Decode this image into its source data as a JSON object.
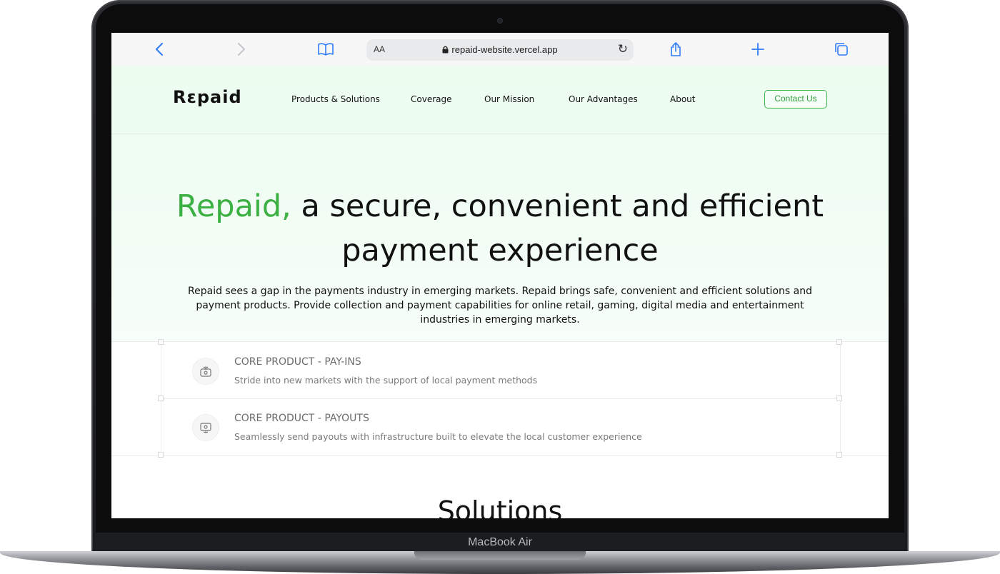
{
  "device": {
    "label": "MacBook Air"
  },
  "browser": {
    "back_icon": "chevron-left-icon",
    "forward_icon": "chevron-right-icon",
    "bookmarks_icon": "book-icon",
    "text_size_label": "AA",
    "url": "repaid-website.vercel.app",
    "lock_icon": "lock-icon",
    "reload_icon": "reload-icon",
    "share_icon": "share-icon",
    "new_tab_icon": "plus-icon",
    "tabs_icon": "tabs-icon",
    "accent_color": "#2f7cf6"
  },
  "site": {
    "logo": "Rɛpaid",
    "nav": {
      "items": [
        "Products & Solutions",
        "Coverage",
        "Our Mission",
        "Our Advantages",
        "About"
      ],
      "contact_label": "Contact Us"
    },
    "hero": {
      "title_accent": "Repaid,",
      "title_rest": " a secure, convenient and efficient payment experience",
      "description": "Repaid sees a gap in the payments industry in emerging markets. Repaid brings safe, convenient and efficient solutions and payment products. Provide collection and payment capabilities for online retail, gaming, digital media and entertainment industries in emerging markets."
    },
    "features": [
      {
        "title": "CORE PRODUCT - PAY-INS",
        "subtitle": "Stride into new markets with the support of local payment methods",
        "icon": "pay-in-icon"
      },
      {
        "title": "CORE PRODUCT - PAYOUTS",
        "subtitle": "Seamlessly send payouts with infrastructure built to elevate the local customer experience",
        "icon": "payout-icon"
      }
    ],
    "section_heading": "Solutions",
    "colors": {
      "brand_green": "#3cb043",
      "hero_bg": "#ecfdf0"
    }
  }
}
